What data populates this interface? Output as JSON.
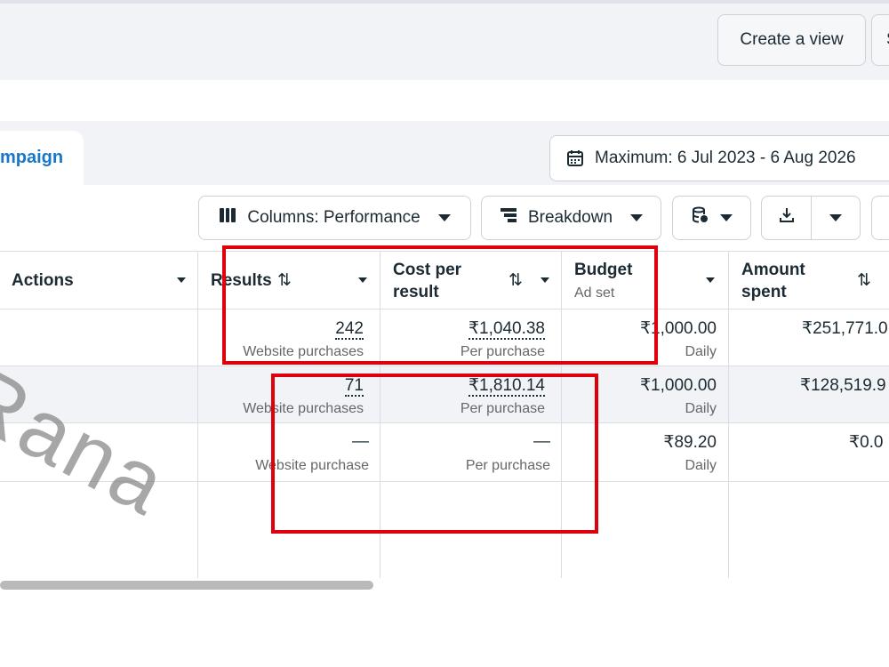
{
  "toolbar": {
    "create_view_label": "Create a view",
    "cut_button_label": "S"
  },
  "tabs": {
    "campaign_label": "mpaign"
  },
  "date_range": {
    "label": "Maximum: 6 Jul 2023 - 6 Aug 2026",
    "icon": "calendar-icon"
  },
  "controls": {
    "columns_label": "Columns: Performance",
    "breakdown_label": "Breakdown",
    "columns_icon": "columns-icon",
    "breakdown_icon": "breakdown-icon",
    "db_icon": "database-icon",
    "export_icon": "download-icon"
  },
  "table": {
    "headers": {
      "actions": "Actions",
      "results": "Results",
      "cost_per_result": [
        "Cost per",
        "result"
      ],
      "budget": "Budget",
      "budget_sub": "Ad set",
      "amount_spent": [
        "Amount",
        "spent"
      ]
    },
    "rows": [
      {
        "results": "242",
        "results_sub": "Website purchases",
        "cost": "₹1,040.38",
        "cost_sub": "Per purchase",
        "budget": "₹1,000.00",
        "budget_sub": "Daily",
        "spent": "₹251,771.0"
      },
      {
        "results": "71",
        "results_sub": "Website purchases",
        "cost": "₹1,810.14",
        "cost_sub": "Per purchase",
        "budget": "₹1,000.00",
        "budget_sub": "Daily",
        "spent": "₹128,519.9"
      },
      {
        "results": "—",
        "results_sub": "Website purchase",
        "cost": "—",
        "cost_sub": "Per purchase",
        "budget": "₹89.20",
        "budget_sub": "Daily",
        "spent": "₹0.0"
      }
    ]
  },
  "watermark": "Rana",
  "colors": {
    "accent": "#1877c9",
    "highlight_box": "#e0000b"
  }
}
